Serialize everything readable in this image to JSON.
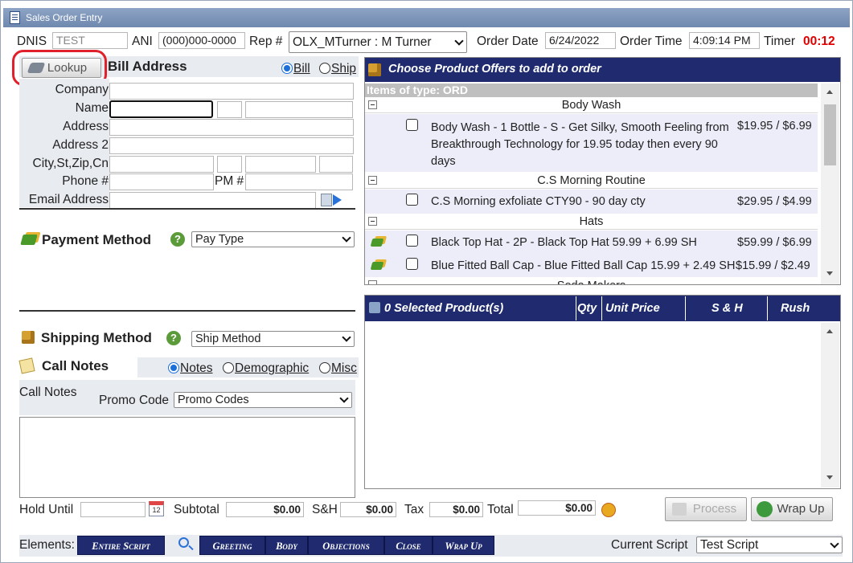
{
  "window": {
    "title": "Sales Order Entry"
  },
  "header": {
    "dnis_label": "DNIS",
    "dnis_value": "TEST",
    "ani_label": "ANI",
    "ani_value": "(000)000-0000",
    "rep_label": "Rep #",
    "rep_value": "OLX_MTurner : M Turner",
    "order_date_label": "Order Date",
    "order_date_value": "6/24/2022",
    "order_time_label": "Order Time",
    "order_time_value": "4:09:14 PM",
    "timer_label": "Timer",
    "timer_value": "00:12",
    "timer_color": "#e00000"
  },
  "bill": {
    "lookup_label": "Lookup",
    "title": "Bill Address",
    "radio_bill": "Bill",
    "radio_ship": "Ship",
    "company_label": "Company",
    "name_label": "Name",
    "address_label": "Address",
    "address2_label": "Address 2",
    "city_label": "City,St,Zip,Cn",
    "phone_label": "Phone #",
    "pm_label": "PM #",
    "email_label": "Email Address"
  },
  "payment": {
    "title": "Payment Method",
    "select_value": "Pay Type"
  },
  "shipping": {
    "title": "Shipping Method",
    "select_value": "Ship Method"
  },
  "notes": {
    "title": "Call Notes",
    "tabs": [
      "Notes",
      "Demographic",
      "Misc"
    ],
    "call_notes_label": "Call Notes",
    "promo_label": "Promo Code",
    "promo_value": "Promo Codes"
  },
  "offers": {
    "title": "Choose Product Offers to add to order",
    "type_label": "Items of type: ORD",
    "groups": [
      {
        "name": "Body Wash"
      },
      {
        "name": "C.S Morning Routine"
      },
      {
        "name": "Hats"
      },
      {
        "name": "Soda Makers"
      }
    ],
    "products": [
      {
        "desc": "Body Wash - 1 Bottle - S - Get Silky, Smooth Feeling from Breakthrough Technology for 19.95 today then every 90 days",
        "price": "$19.95 / $6.99"
      },
      {
        "desc": "C.S Morning exfoliate CTY90 - 90 day cty",
        "price": "$29.95 / $4.99"
      },
      {
        "desc": "Black Top Hat - 2P - Black Top Hat 59.99 + 6.99 SH",
        "price": "$59.99 / $6.99"
      },
      {
        "desc": "Blue Fitted Ball Cap - Blue Fitted Ball Cap 15.99 + 2.49 SH",
        "price": "$15.99 / $2.49"
      }
    ]
  },
  "selected": {
    "title": "0 Selected Product(s)",
    "col_qty": "Qty",
    "col_unit": "Unit Price",
    "col_sh": "S & H",
    "col_rush": "Rush"
  },
  "totals": {
    "hold_label": "Hold Until",
    "subtotal_label": "Subtotal",
    "subtotal_value": "$0.00",
    "sh_label": "S&H",
    "sh_value": "$0.00",
    "tax_label": "Tax",
    "tax_value": "$0.00",
    "total_label": "Total",
    "total_value": "$0.00",
    "process_label": "Process",
    "wrapup_label": "Wrap Up"
  },
  "footer": {
    "elements_label": "Elements:",
    "buttons": [
      "Entire Script",
      "Greeting",
      "Body",
      "Objections",
      "Close",
      "Wrap Up"
    ],
    "current_script_label": "Current Script",
    "current_script_value": "Test Script"
  },
  "colors": {
    "nav_dark": "#1f2b6e",
    "highlight_ring": "#e0202a"
  }
}
